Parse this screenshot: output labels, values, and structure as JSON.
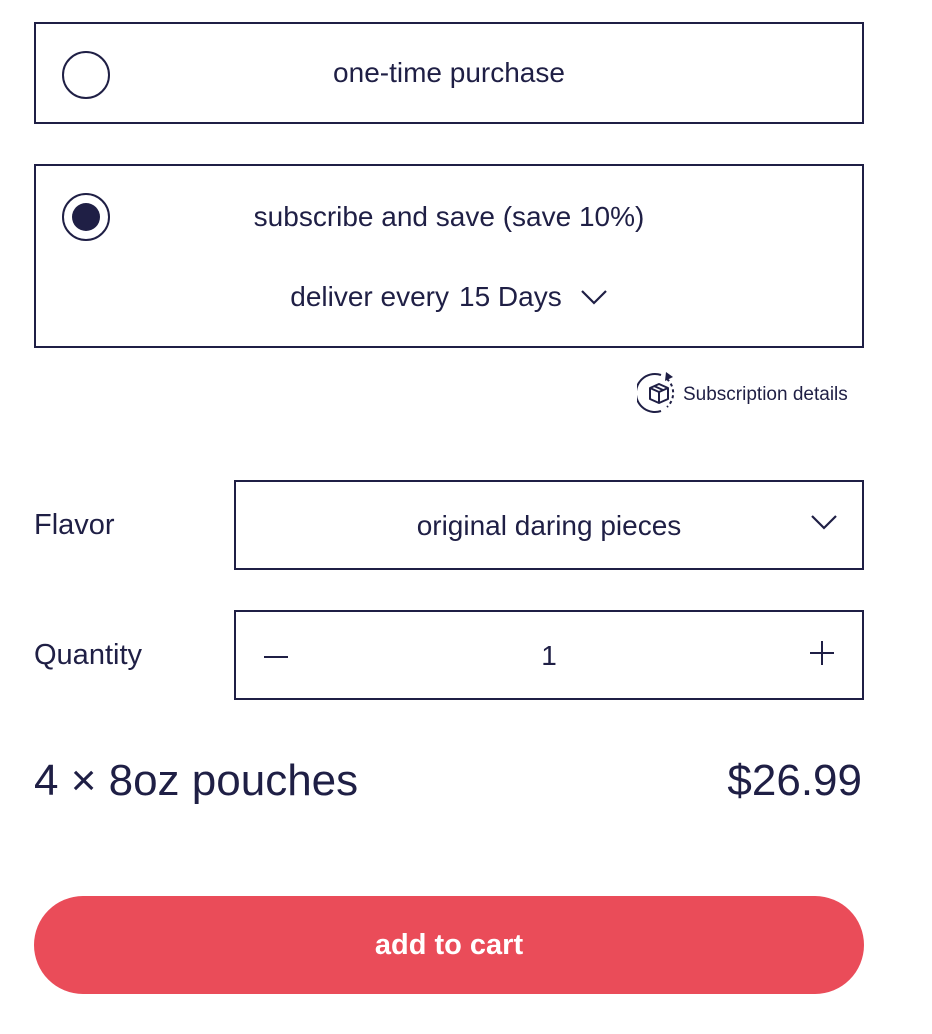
{
  "colors": {
    "text": "#1f1f45",
    "accent": "#ea4c59",
    "background": "#ffffff"
  },
  "purchase_options": {
    "one_time": {
      "label": "one-time purchase",
      "selected": false
    },
    "subscribe": {
      "label": "subscribe and save (save 10%)",
      "selected": true,
      "deliver_label": "deliver every",
      "deliver_value": "15 Days",
      "deliver_icon": "chevron-down-icon"
    }
  },
  "subscription_details": {
    "label": "Subscription details",
    "icon": "recurring-box-icon"
  },
  "flavor": {
    "label": "Flavor",
    "value": "original daring pieces",
    "icon": "chevron-down-icon"
  },
  "quantity": {
    "label": "Quantity",
    "value": "1",
    "decrement_icon": "minus-icon",
    "increment_icon": "plus-icon"
  },
  "product": {
    "pack_size": "4 × 8oz pouches",
    "price": "$26.99"
  },
  "cart": {
    "button_label": "add to cart"
  }
}
